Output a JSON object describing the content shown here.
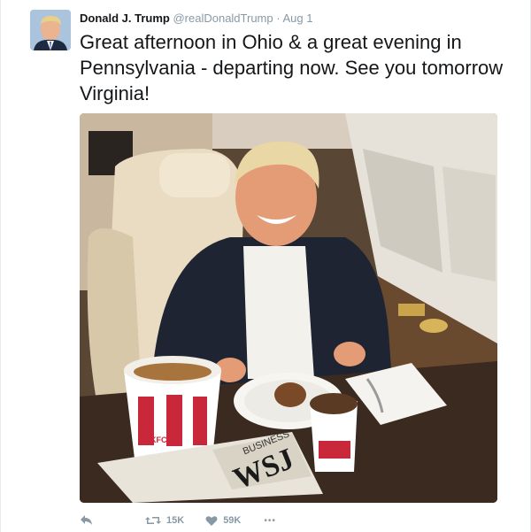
{
  "tweet": {
    "author_name": "Donald J. Trump",
    "handle": "@realDonaldTrump",
    "separator": "·",
    "time": "Aug 1",
    "text": "Great afternoon in Ohio & a great evening in Pennsylvania - departing now. See you tomorrow Virginia!"
  },
  "photo": {
    "bucket_brand": "KFC",
    "newspaper_headline": "WSJ",
    "newspaper_section": "BUSINESS"
  },
  "actions": {
    "reply_icon": "reply-icon",
    "retweet_icon": "retweet-icon",
    "retweet_count": "15K",
    "like_icon": "heart-icon",
    "like_count": "59K",
    "more_icon": "more-icon",
    "more_label": "•••"
  },
  "colors": {
    "text": "#14171a",
    "secondary": "#8899a6",
    "border": "#e6ecf0"
  }
}
